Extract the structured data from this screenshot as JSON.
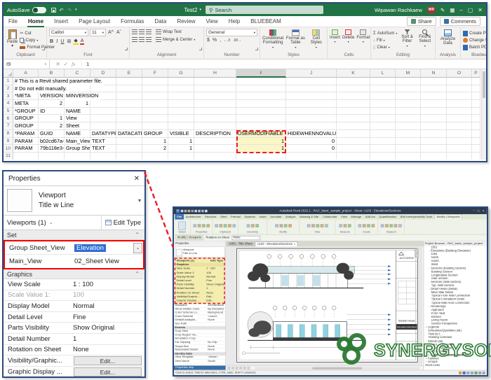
{
  "colors": {
    "excel_green": "#217346",
    "annotation_red": "#ee1c25",
    "highlight_yellow": "#fbf6c6",
    "revit_highlight_yellow": "#f3eeae",
    "logo_green": "#2c7a33",
    "selection_blue": "#2f6fd3"
  },
  "excel": {
    "titlebar": {
      "autosave": "AutoSave",
      "title": "Test2",
      "search": "Search",
      "user": "Wipawan Rachkaew",
      "initials": "WR"
    },
    "menu": {
      "items": [
        "File",
        "Home",
        "Insert",
        "Page Layout",
        "Formulas",
        "Data",
        "Review",
        "View",
        "Help",
        "BLUEBEAM"
      ],
      "active": "Home",
      "share": "Share",
      "comments": "Comments"
    },
    "ribbon": {
      "paste": "Paste",
      "cut": "Cut",
      "copy": "Copy",
      "format_painter": "Format Painter",
      "font_name": "Calibri",
      "font_size": "11",
      "wrap_text": "Wrap Text",
      "merge_center": "Merge & Center",
      "number_format": "General",
      "cond_fmt": "Conditional Formatting",
      "format_table": "Format as Table",
      "cell_styles": "Cell Styles",
      "insert": "Insert",
      "delete": "Delete",
      "format": "Format",
      "autosum": "AutoSum",
      "fill": "Fill",
      "clear": "Clear",
      "sort_filter": "Sort & Filter",
      "find_select": "Find & Select",
      "analyze": "Analyze Data",
      "bluebeam": [
        "Create PDF",
        "Change Settings",
        "Batch PDF"
      ],
      "groups": [
        "Clipboard",
        "Font",
        "Alignment",
        "Number",
        "Styles",
        "Cells",
        "Editing",
        "Analysis",
        "Bluebeam"
      ]
    },
    "formula_bar": {
      "name_box": "I9",
      "fx": "fx",
      "value": "1"
    },
    "columns": [
      "A",
      "B",
      "C",
      "D",
      "E",
      "F",
      "G",
      "H",
      "I",
      "J",
      "K",
      "L",
      "M",
      "N",
      "O",
      "P"
    ],
    "selected_column": "I",
    "sheet": {
      "rows": [
        {
          "n": 1,
          "cells": [
            {
              "c": 0,
              "t": "# This is a Revit shared parameter file.",
              "ovf": true
            }
          ]
        },
        {
          "n": 2,
          "cells": [
            {
              "c": 0,
              "t": "# Do not edit manually.",
              "ovf": true
            }
          ]
        },
        {
          "n": 3,
          "cells": [
            {
              "c": 0,
              "t": "*META"
            },
            {
              "c": 1,
              "t": "VERSION"
            },
            {
              "c": 2,
              "t": "MINVERSION",
              "ovf": true
            }
          ]
        },
        {
          "n": 4,
          "cells": [
            {
              "c": 0,
              "t": "META"
            },
            {
              "c": 1,
              "t": "2",
              "num": true
            },
            {
              "c": 2,
              "t": "1",
              "num": true
            }
          ]
        },
        {
          "n": 5,
          "cells": [
            {
              "c": 0,
              "t": "*GROUP"
            },
            {
              "c": 1,
              "t": "ID"
            },
            {
              "c": 2,
              "t": "NAME"
            }
          ]
        },
        {
          "n": 6,
          "cells": [
            {
              "c": 0,
              "t": "GROUP"
            },
            {
              "c": 1,
              "t": "1",
              "num": true
            },
            {
              "c": 2,
              "t": "View"
            }
          ]
        },
        {
          "n": 7,
          "cells": [
            {
              "c": 0,
              "t": "GROUP"
            },
            {
              "c": 1,
              "t": "2",
              "num": true
            },
            {
              "c": 2,
              "t": "Sheet"
            }
          ]
        },
        {
          "n": 8,
          "cells": [
            {
              "c": 0,
              "t": "*PARAM"
            },
            {
              "c": 1,
              "t": "GUID"
            },
            {
              "c": 2,
              "t": "NAME"
            },
            {
              "c": 3,
              "t": "DATATYPE"
            },
            {
              "c": 4,
              "t": "DATACATE"
            },
            {
              "c": 5,
              "t": "GROUP"
            },
            {
              "c": 6,
              "t": "VISIBLE"
            },
            {
              "c": 7,
              "t": "DESCRIPTION"
            },
            {
              "c": 8,
              "t": "USERMODIFIABLE",
              "hl": true
            },
            {
              "c": 9,
              "t": "HIDEWHENNOVALUE"
            }
          ]
        },
        {
          "n": 9,
          "cells": [
            {
              "c": 0,
              "t": "PARAM"
            },
            {
              "c": 1,
              "t": "b02cd67a-"
            },
            {
              "c": 2,
              "t": "Main_View"
            },
            {
              "c": 3,
              "t": "TEXT"
            },
            {
              "c": 5,
              "t": "1",
              "num": true
            },
            {
              "c": 6,
              "t": "1",
              "num": true
            },
            {
              "c": 8,
              "t": "1",
              "num": true,
              "hl": true
            },
            {
              "c": 9,
              "t": "0",
              "num": true
            }
          ]
        },
        {
          "n": 10,
          "cells": [
            {
              "c": 0,
              "t": "PARAM"
            },
            {
              "c": 1,
              "t": "79b118e3-"
            },
            {
              "c": 2,
              "t": "Group She"
            },
            {
              "c": 3,
              "t": "TEXT"
            },
            {
              "c": 5,
              "t": "2",
              "num": true
            },
            {
              "c": 6,
              "t": "1",
              "num": true
            },
            {
              "c": 8,
              "t": "1",
              "num": true,
              "hl": true
            },
            {
              "c": 9,
              "t": "0",
              "num": true
            }
          ]
        },
        {
          "n": 11,
          "cells": []
        }
      ]
    }
  },
  "properties_panel": {
    "title": "Properties",
    "type_name": "Viewport",
    "type_style": "Title w Line",
    "selector": "Viewports (1)",
    "edit_type": "Edit Type",
    "set_header": "Set",
    "set_rows": [
      {
        "label": "Group Sheet_View",
        "value": "Elevation"
      },
      {
        "label": "Main_View",
        "value": "02_Sheet View"
      }
    ],
    "graphics_header": "Graphics",
    "graphics_rows": [
      {
        "label": "View Scale",
        "value": "1 : 100"
      },
      {
        "label": "Scale Value    1:",
        "value": "100",
        "disabled": true
      },
      {
        "label": "Display Model",
        "value": "Normal"
      },
      {
        "label": "Detail Level",
        "value": "Fine"
      },
      {
        "label": "Parts Visibility",
        "value": "Show Original"
      },
      {
        "label": "Detail Number",
        "value": "1"
      },
      {
        "label": "Rotation on Sheet",
        "value": "None"
      },
      {
        "label": "Visibility/Graphic...",
        "button": "Edit..."
      },
      {
        "label": "Graphic Display ...",
        "button": "Edit..."
      }
    ]
  },
  "revit": {
    "title": "Autodesk Revit 2022.1 - RAC_basic_sample_project - Sheet: A103 - Elevations/Sections",
    "tabs": [
      "File",
      "Architecture",
      "Structure",
      "Steel",
      "Precast",
      "Systems",
      "Insert",
      "Annotate",
      "Analyze",
      "Massing & Site",
      "Collaborate",
      "View",
      "Manage",
      "Add-Ins",
      "Quantification",
      "BIM Interoperability Tools",
      "Modify | Viewports"
    ],
    "panels": [
      "Select",
      "Properties",
      "Clipboard",
      "Geometry",
      "Modify",
      "View",
      "Measure",
      "Create",
      "Viewport"
    ],
    "options_bar": {
      "context": "Modify | Viewports",
      "label": "Rotation on Sheet",
      "value": "None"
    },
    "view_tabs": [
      {
        "label": "A001 - Title Sheet",
        "active": false
      },
      {
        "label": "A103 - Elevations/Sections",
        "active": true
      }
    ],
    "mini_properties": {
      "header": "Properties",
      "type_name": "Viewport",
      "type_style": "Title w Line",
      "selector": "Viewports (1)",
      "edit_type": "Edit Type",
      "graphics_header": "Graphics",
      "rows": [
        {
          "l": "View Scale",
          "v": "1 : 100"
        },
        {
          "l": "Scale Value   1:",
          "v": "100"
        },
        {
          "l": "Display Model",
          "v": "Normal"
        },
        {
          "l": "Detail Level",
          "v": "Fine"
        },
        {
          "l": "Parts Visibility",
          "v": "Show Original"
        },
        {
          "l": "Detail Number",
          "v": "1"
        },
        {
          "l": "Rotation on Sheet",
          "v": "None"
        },
        {
          "l": "Visibility/Graphic...",
          "v": "Edit..."
        },
        {
          "l": "Graphic Display ...",
          "v": "Edit..."
        }
      ],
      "lower_rows": [
        {
          "l": "Discipline",
          "v": "Architectural"
        },
        {
          "l": "Show Hidden Lines",
          "v": "By Discipline"
        },
        {
          "l": "Color Scheme Lo...",
          "v": "Background"
        },
        {
          "l": "Color Scheme",
          "v": "<none>"
        },
        {
          "l": "Default Analysis...",
          "v": "None"
        },
        {
          "l": "Sun Path",
          "v": ""
        },
        {
          "l": "Extents",
          "hdr": true
        },
        {
          "l": "Crop View",
          "v": ""
        },
        {
          "l": "Crop Region Vis...",
          "v": ""
        },
        {
          "l": "Annotation Crop",
          "v": ""
        },
        {
          "l": "Far Clipping",
          "v": "No Clip"
        },
        {
          "l": "Scope Box",
          "v": "None"
        },
        {
          "l": "Associated Datum",
          "v": "None"
        },
        {
          "l": "Identity Data",
          "hdr": true
        },
        {
          "l": "View Template",
          "v": "<None>"
        },
        {
          "l": "View Name",
          "v": "South"
        }
      ],
      "help": "Properties help"
    },
    "browser": {
      "header": "Project Browser - RAC_basic_sample_project",
      "items": [
        {
          "t": "(3D)",
          "d": 2
        },
        {
          "t": "Elevations (Building Elevation)",
          "d": 1,
          "n": "-"
        },
        {
          "t": "East",
          "d": 2
        },
        {
          "t": "North",
          "d": 2
        },
        {
          "t": "South",
          "d": 2
        },
        {
          "t": "West",
          "d": 2
        },
        {
          "t": "Sections (Building Section)",
          "d": 1,
          "n": "-"
        },
        {
          "t": "Building Section",
          "d": 2
        },
        {
          "t": "Longitudinal Section",
          "d": 2
        },
        {
          "t": "Stair Section",
          "d": 2
        },
        {
          "t": "Sections (Wall Section)",
          "d": 1,
          "n": "-"
        },
        {
          "t": "Typ. Wall Section",
          "d": 2
        },
        {
          "t": "Detail Views (Detail)",
          "d": 1,
          "n": "-"
        },
        {
          "t": "Main Stair Detail",
          "d": 2
        },
        {
          "t": "Typical Floor Wall Connection",
          "d": 2
        },
        {
          "t": "Typical Foundation Detail",
          "d": 2
        },
        {
          "t": "Typical Wall Roof Connection",
          "d": 2
        },
        {
          "t": "Renderings",
          "d": 1,
          "n": "-"
        },
        {
          "t": "Approach",
          "d": 2
        },
        {
          "t": "From Yard",
          "d": 2
        },
        {
          "t": "Kitchen",
          "d": 2
        },
        {
          "t": "Living Room",
          "d": 2
        },
        {
          "t": "Section Perspective",
          "d": 2
        },
        {
          "t": "Legends",
          "d": 0,
          "n": "+"
        },
        {
          "t": "Schedules/Quantities (all)",
          "d": 0,
          "n": "-"
        },
        {
          "t": "How do I...",
          "d": 1
        },
        {
          "t": "Planting Schedule",
          "d": 1
        },
        {
          "t": "Sheets (all)",
          "d": 0,
          "n": "-"
        },
        {
          "t": "A001 - Title Sheet",
          "d": 1,
          "n": "+"
        },
        {
          "t": "A101 - Site Plan",
          "d": 1,
          "n": "+"
        },
        {
          "t": "A102 - Plans",
          "d": 1,
          "n": "+"
        },
        {
          "t": "A103 - Elevations/Sections",
          "d": 1,
          "n": "+",
          "bold": true
        },
        {
          "t": "Families",
          "d": 0,
          "n": "+"
        },
        {
          "t": "Groups",
          "d": 0,
          "n": "+"
        },
        {
          "t": "Revit Links",
          "d": 0
        }
      ]
    },
    "sheet": {
      "autodesk": "AUTODESK",
      "project": "Sample House",
      "sheet_name": "Elevations/Sections"
    },
    "status": "Click to select, TAB for alternates, CTRL adds, SHIFT unselects."
  },
  "logo": {
    "text": "SYNERGYSOFT"
  }
}
